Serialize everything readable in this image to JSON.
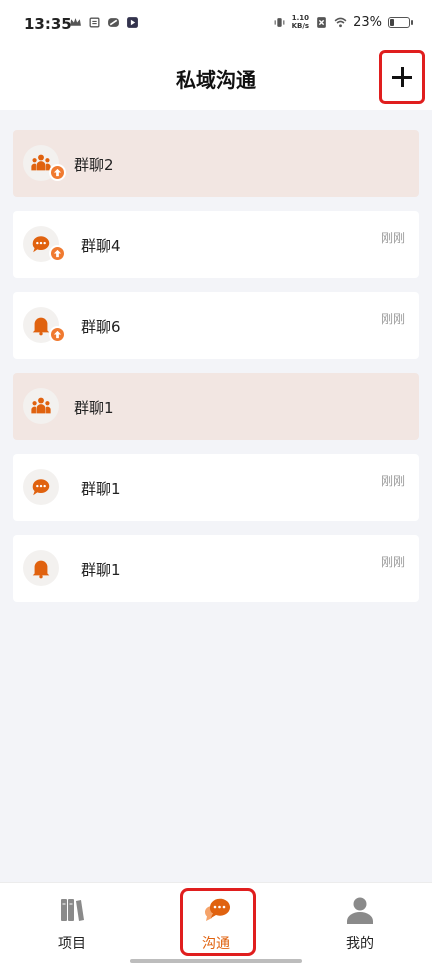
{
  "status_bar": {
    "time": "13:35",
    "net_speed_value": "1.10",
    "net_speed_unit": "KB/s",
    "battery_text": "23%",
    "battery_level": 0.23
  },
  "header": {
    "title": "私域沟通"
  },
  "chat_list": [
    {
      "name": "群聊2",
      "time": "",
      "pinned": true,
      "icon": "group-icon",
      "badge": true
    },
    {
      "name": "群聊4",
      "time": "刚刚",
      "pinned": false,
      "icon": "chat-bubble-icon",
      "badge": true
    },
    {
      "name": "群聊6",
      "time": "刚刚",
      "pinned": false,
      "icon": "bell-icon",
      "badge": true
    },
    {
      "name": "群聊1",
      "time": "",
      "pinned": true,
      "icon": "group-icon",
      "badge": false
    },
    {
      "name": "群聊1",
      "time": "刚刚",
      "pinned": false,
      "icon": "chat-bubble-icon",
      "badge": false
    },
    {
      "name": "群聊1",
      "time": "刚刚",
      "pinned": false,
      "icon": "bell-icon",
      "badge": false
    }
  ],
  "tabbar": {
    "items": [
      {
        "label": "项目",
        "icon": "books-icon",
        "active": false
      },
      {
        "label": "沟通",
        "icon": "chat-bubbles-icon",
        "active": true
      },
      {
        "label": "我的",
        "icon": "person-icon",
        "active": false
      }
    ]
  },
  "colors": {
    "accent": "#e0620f",
    "badge": "#f07a30",
    "pinned_bg": "#f2e6e2",
    "highlight_border": "#e01e1e"
  }
}
